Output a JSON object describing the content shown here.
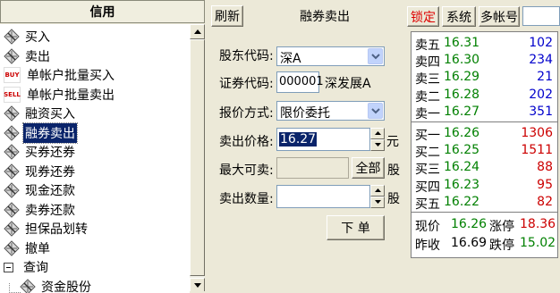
{
  "sidebar": {
    "header": "信用",
    "items": [
      {
        "label": "买入",
        "icon": "order-icon"
      },
      {
        "label": "卖出",
        "icon": "order-icon"
      },
      {
        "label": "单帐户批量买入",
        "icon": "buy-tag-icon",
        "tag": "BUY"
      },
      {
        "label": "单帐户批量卖出",
        "icon": "sell-tag-icon",
        "tag": "SELL"
      },
      {
        "label": "融资买入",
        "icon": "order-icon"
      },
      {
        "label": "融券卖出",
        "icon": "order-icon"
      },
      {
        "label": "买券还券",
        "icon": "order-icon"
      },
      {
        "label": "现券还券",
        "icon": "order-icon"
      },
      {
        "label": "现金还款",
        "icon": "order-icon"
      },
      {
        "label": "卖券还款",
        "icon": "order-icon"
      },
      {
        "label": "担保品划转",
        "icon": "order-icon"
      },
      {
        "label": "撤单",
        "icon": "order-icon"
      },
      {
        "label": "查询",
        "icon": "collapse-icon"
      },
      {
        "label": "资金股份",
        "icon": "order-icon"
      }
    ]
  },
  "toolbar": {
    "refresh": "刷新",
    "title": "融券卖出",
    "lock": "锁定",
    "system": "系统",
    "multi_account": "多帐号"
  },
  "form": {
    "account_label": "股东代码:",
    "account_value": "深A",
    "code_label": "证券代码:",
    "code_value": "000001",
    "stock_name": "深发展A",
    "price_type_label": "报价方式:",
    "price_type_value": "限价委托",
    "price_label": "卖出价格:",
    "price_value": "16.27",
    "price_unit": "元",
    "max_label": "最大可卖:",
    "max_value": "",
    "all_button": "全部",
    "max_unit": "股",
    "qty_label": "卖出数量:",
    "qty_value": "",
    "qty_unit": "股",
    "submit": "下 单"
  },
  "quote": {
    "asks": [
      {
        "name": "卖五",
        "price": "16.31",
        "vol": "102"
      },
      {
        "name": "卖四",
        "price": "16.30",
        "vol": "234"
      },
      {
        "name": "卖三",
        "price": "16.29",
        "vol": "21"
      },
      {
        "name": "卖二",
        "price": "16.28",
        "vol": "202"
      },
      {
        "name": "卖一",
        "price": "16.27",
        "vol": "351"
      }
    ],
    "bids": [
      {
        "name": "买一",
        "price": "16.26",
        "vol": "1306"
      },
      {
        "name": "买二",
        "price": "16.25",
        "vol": "1511"
      },
      {
        "name": "买三",
        "price": "16.24",
        "vol": "88"
      },
      {
        "name": "买四",
        "price": "16.23",
        "vol": "95"
      },
      {
        "name": "买五",
        "price": "16.22",
        "vol": "82"
      }
    ],
    "stats": {
      "last_label": "现价",
      "last": "16.26",
      "limit_up_label": "涨停",
      "limit_up": "18.36",
      "prev_label": "昨收",
      "prev": "16.69",
      "limit_down_label": "跌停",
      "limit_down": "15.02"
    }
  },
  "colors": {
    "ask_vol": "#0000cc",
    "bid_vol": "#cc0000",
    "price": "#008000",
    "limit_up": "#cc0000",
    "limit_down": "#008000",
    "selection": "#0a246a"
  }
}
